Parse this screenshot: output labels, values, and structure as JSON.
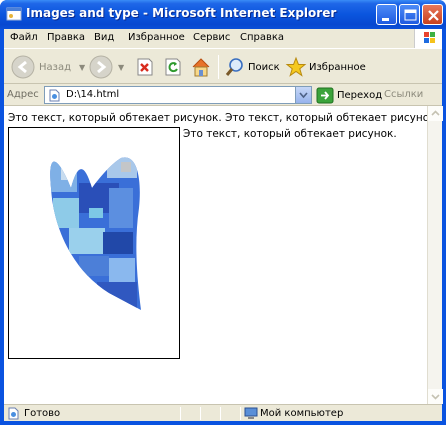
{
  "window": {
    "title": "Images and type - Microsoft Internet Explorer"
  },
  "menu": {
    "items": [
      "Файл",
      "Правка",
      "Вид",
      "Избранное",
      "Сервис",
      "Справка"
    ]
  },
  "toolbar": {
    "back_label": "Назад",
    "search_label": "Поиск",
    "favorites_label": "Избранное"
  },
  "address": {
    "label": "Адрес",
    "value": "D:\\14.html",
    "go_label": "Переход",
    "links_label": "Ссылки"
  },
  "page": {
    "line1": "Это текст, который обтекает рисунок. Это текст, который обтекает рисунок.",
    "line2": "Это текст, который обтекает рисунок."
  },
  "status": {
    "text": "Готово",
    "zone": "Мой компьютер"
  },
  "colors": {
    "titlebar": "#0A55DE",
    "chrome": "#ECE9D8"
  }
}
